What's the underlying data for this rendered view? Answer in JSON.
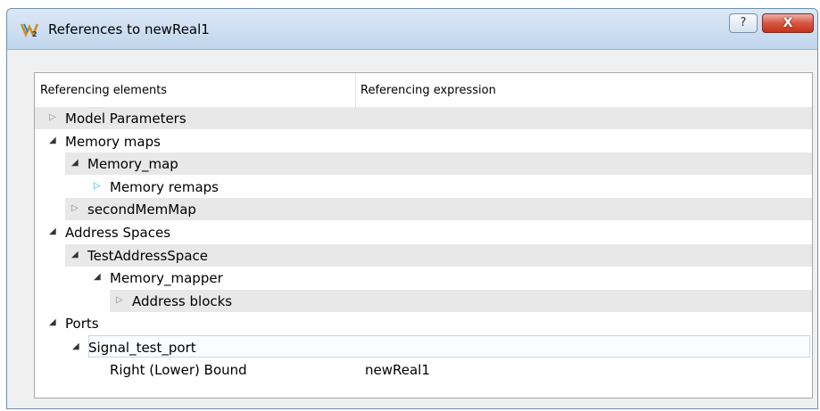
{
  "window": {
    "title": "References to newReal1",
    "app_icon": "kactus-logo-icon",
    "help_label": "?",
    "close_label": "X"
  },
  "tree": {
    "columns": [
      "Referencing elements",
      "Referencing expression"
    ],
    "rows": [
      {
        "label": "Model Parameters",
        "level": 0,
        "state": "collapsed",
        "expr": ""
      },
      {
        "label": "Memory maps",
        "level": 0,
        "state": "expanded",
        "expr": ""
      },
      {
        "label": "Memory_map",
        "level": 1,
        "state": "expanded",
        "expr": ""
      },
      {
        "label": "Memory remaps",
        "level": 2,
        "state": "collapsed-hover",
        "expr": ""
      },
      {
        "label": "secondMemMap",
        "level": 1,
        "state": "collapsed",
        "expr": ""
      },
      {
        "label": "Address Spaces",
        "level": 0,
        "state": "expanded",
        "expr": ""
      },
      {
        "label": "TestAddressSpace",
        "level": 1,
        "state": "expanded",
        "expr": ""
      },
      {
        "label": "Memory_mapper",
        "level": 2,
        "state": "expanded",
        "expr": ""
      },
      {
        "label": "Address blocks",
        "level": 3,
        "state": "collapsed",
        "expr": ""
      },
      {
        "label": "Ports",
        "level": 0,
        "state": "expanded",
        "expr": ""
      },
      {
        "label": "Signal_test_port",
        "level": 1,
        "state": "expanded-selected",
        "expr": ""
      },
      {
        "label": "Right (Lower) Bound",
        "level": 2,
        "state": "leaf",
        "expr": "newReal1"
      }
    ]
  },
  "colors": {
    "row_shade": "#e8e8e8",
    "selection_border": "#c9d7e9",
    "hover_arrow": "#27a9e1",
    "close_button": "#c4321e"
  }
}
